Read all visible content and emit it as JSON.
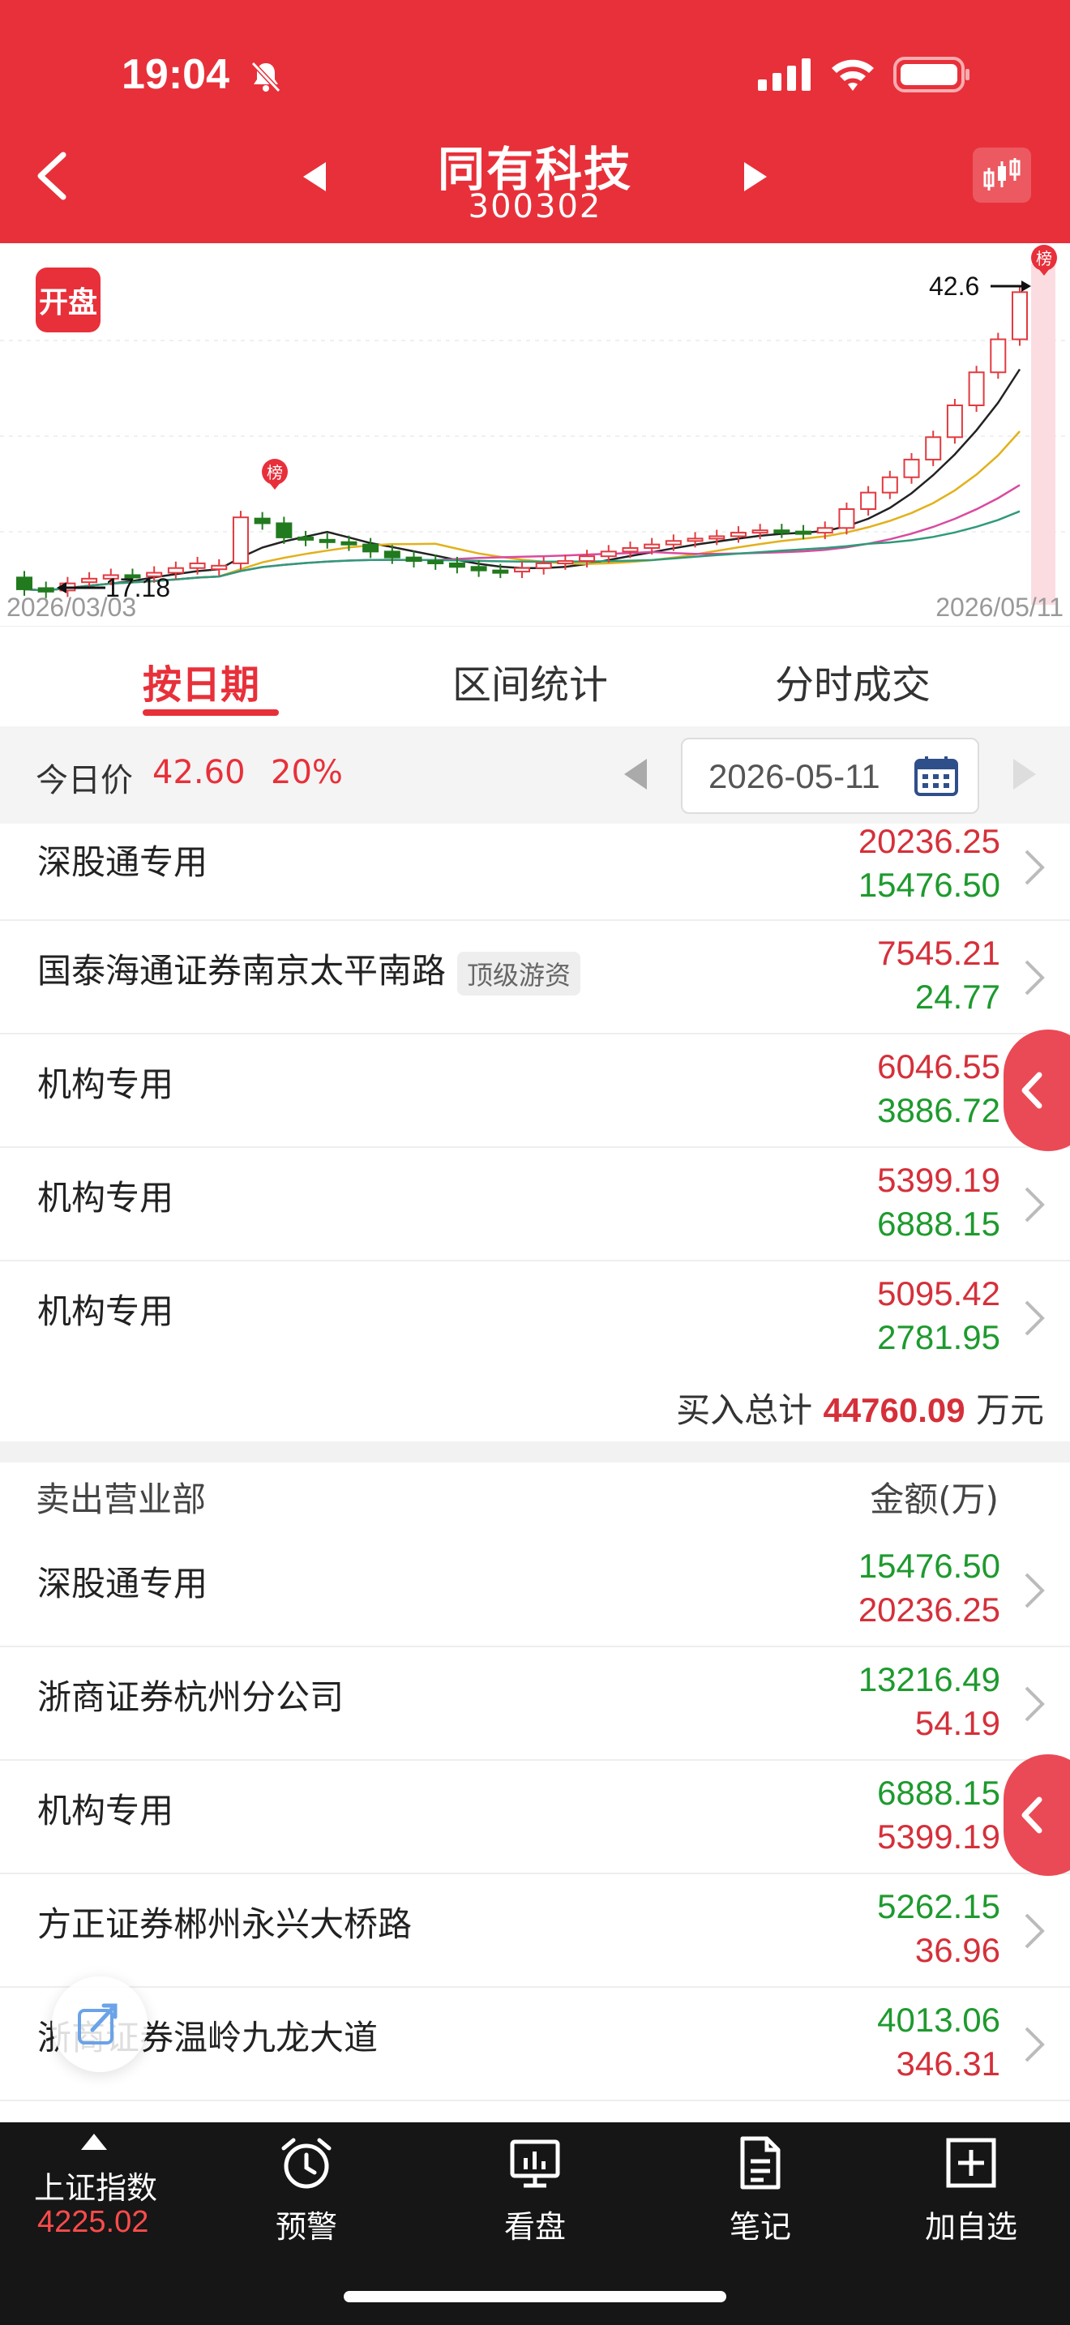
{
  "status_bar": {
    "time": "19:04"
  },
  "header": {
    "stock_name": "同有科技",
    "stock_code": "300302"
  },
  "chart": {
    "badge": "开盘",
    "start_date": "2026/03/03",
    "end_date": "2026/05/11",
    "low_label": "17.18",
    "high_label": "42.6",
    "marker_label": "榜"
  },
  "tabs": [
    {
      "label": "按日期",
      "active": true
    },
    {
      "label": "区间统计",
      "active": false
    },
    {
      "label": "分时成交",
      "active": false
    }
  ],
  "date_bar": {
    "today_label": "今日价",
    "price": "42.60",
    "change": "20%",
    "date": "2026-05-11"
  },
  "buy_rows": [
    {
      "name": "深股通专用",
      "tag": "",
      "buy": "20236.25",
      "sell": "15476.50"
    },
    {
      "name": "国泰海通证券南京太平南路",
      "tag": "顶级游资",
      "buy": "7545.21",
      "sell": "24.77"
    },
    {
      "name": "机构专用",
      "tag": "",
      "buy": "6046.55",
      "sell": "3886.72"
    },
    {
      "name": "机构专用",
      "tag": "",
      "buy": "5399.19",
      "sell": "6888.15"
    },
    {
      "name": "机构专用",
      "tag": "",
      "buy": "5095.42",
      "sell": "2781.95"
    }
  ],
  "buy_total": {
    "label": "买入总计",
    "value": "44760.09",
    "unit": "万元"
  },
  "sell_header": {
    "title": "卖出营业部",
    "amount": "金额(万)"
  },
  "sell_rows": [
    {
      "name": "深股通专用",
      "sell": "15476.50",
      "buy": "20236.25"
    },
    {
      "name": "浙商证券杭州分公司",
      "sell": "13216.49",
      "buy": "54.19"
    },
    {
      "name": "机构专用",
      "sell": "6888.15",
      "buy": "5399.19"
    },
    {
      "name": "方正证券郴州永兴大桥路",
      "sell": "5262.15",
      "buy": "36.96"
    },
    {
      "name": "浙商证券温岭九龙大道",
      "sell": "4013.06",
      "buy": "346.31"
    }
  ],
  "bottom_nav": {
    "index_name": "上证指数",
    "index_value": "4225.02",
    "items": [
      "预警",
      "看盘",
      "笔记",
      "加自选"
    ]
  },
  "colors": {
    "brand": "#e8303a",
    "up": "#d5303a",
    "down": "#1e9a2e"
  }
}
